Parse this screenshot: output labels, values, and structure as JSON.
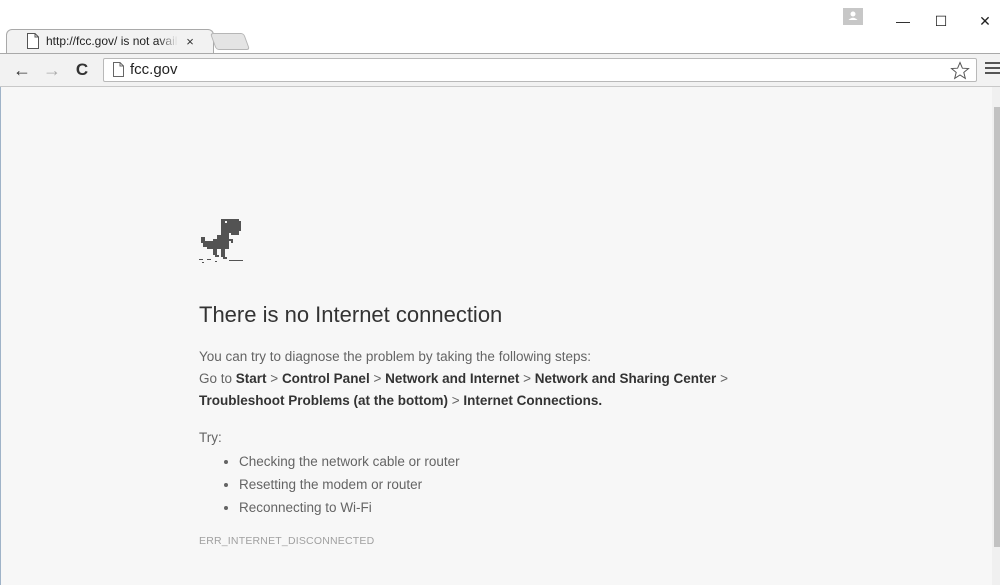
{
  "tab": {
    "title": "http://fcc.gov/ is not available",
    "close_label": "×"
  },
  "window_controls": {
    "minimize": "—",
    "maximize": "☐",
    "close": "✕"
  },
  "toolbar": {
    "back": "←",
    "forward": "→",
    "reload": "C",
    "url": "fcc.gov"
  },
  "error_page": {
    "heading": "There is no Internet connection",
    "intro": "You can try to diagnose the problem by taking the following steps:",
    "path_prefix": "Go to ",
    "path_steps": [
      "Start",
      "Control Panel",
      "Network and Internet",
      "Network and Sharing Center",
      "Troubleshoot Problems (at the bottom)",
      "Internet Connections."
    ],
    "separator": " > ",
    "try_label": "Try:",
    "tips": [
      "Checking the network cable or router",
      "Resetting the modem or router",
      "Reconnecting to Wi-Fi"
    ],
    "error_code": "ERR_INTERNET_DISCONNECTED"
  },
  "colors": {
    "page_background": "#f7f7f7",
    "heading": "#333333",
    "body_text": "#646464",
    "error_code": "#a0a0a0"
  }
}
